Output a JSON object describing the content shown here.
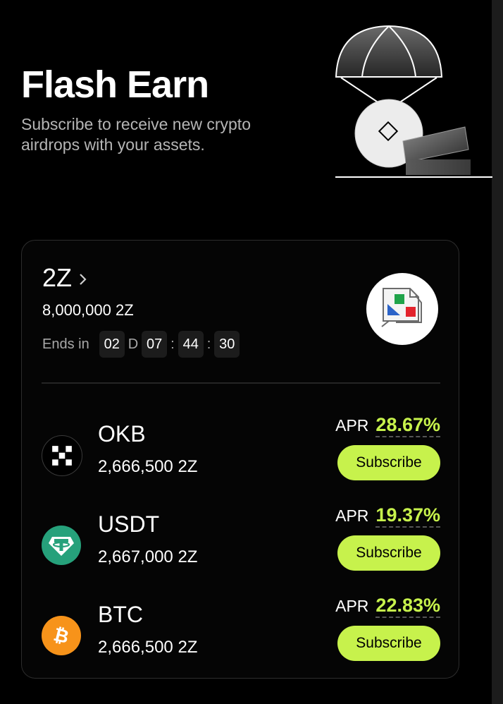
{
  "hero": {
    "title": "Flash Earn",
    "subtitle": "Subscribe to receive new crypto airdrops with your assets.",
    "illustration": "parachute-airdrop-illustration"
  },
  "project": {
    "name": "2Z",
    "total": "8,000,000 2Z",
    "ends_label": "Ends in",
    "countdown": {
      "days": "02",
      "days_unit": "D",
      "hours": "07",
      "sep1": ":",
      "minutes": "44",
      "sep2": ":",
      "seconds": "30"
    },
    "logo": "broken-image-icon"
  },
  "assets": [
    {
      "name": "OKB",
      "amount": "2,666,500 2Z",
      "apr_label": "APR",
      "apr": "28.67%",
      "button": "Subscribe",
      "icon": "okb-icon",
      "icon_color": "#000000"
    },
    {
      "name": "USDT",
      "amount": "2,667,000 2Z",
      "apr_label": "APR",
      "apr": "19.37%",
      "button": "Subscribe",
      "icon": "usdt-icon",
      "icon_color": "#26a17b"
    },
    {
      "name": "BTC",
      "amount": "2,666,500 2Z",
      "apr_label": "APR",
      "apr": "22.83%",
      "button": "Subscribe",
      "icon": "btc-icon",
      "icon_color": "#f7931a"
    }
  ],
  "colors": {
    "accent": "#c7f24c",
    "background": "#000000",
    "card_border": "#2d2d2d",
    "muted_text": "#b5b5b5"
  }
}
